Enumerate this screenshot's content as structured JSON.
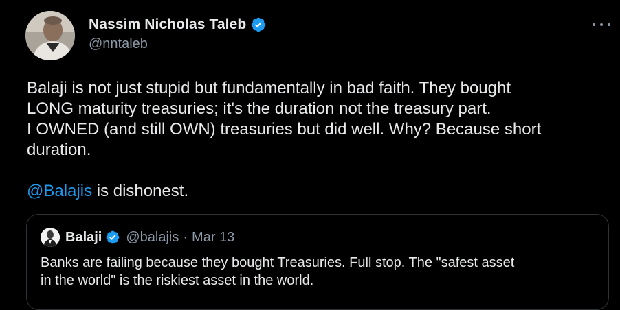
{
  "tweet": {
    "author": {
      "display_name": "Nassim Nicholas Taleb",
      "handle": "@nntaleb",
      "verified": true,
      "avatar_icon": "profile-photo"
    },
    "body_lines": [
      "Balaji is not just stupid but fundamentally in bad faith. They bought",
      "LONG maturity treasuries; it's the duration not the treasury part.",
      "I OWNED (and still OWN) treasuries but did well. Why? Because short",
      "duration."
    ],
    "mention": "@Balajis",
    "mention_suffix": " is dishonest.",
    "more_icon": "more-options-icon"
  },
  "quoted_tweet": {
    "display_name": "Balaji",
    "handle": "@balajis",
    "separator": "·",
    "date": "Mar 13",
    "verified": true,
    "text_lines": [
      "Banks are failing because they bought Treasuries. Full stop. The \"safest asset",
      "in the world\" is the riskiest asset in the world."
    ]
  },
  "colors": {
    "background": "#000000",
    "text_primary": "#e7e9ea",
    "text_secondary": "#8b98a5",
    "link": "#1d9bf0",
    "verified_badge": "#1d9bf0",
    "border": "#2f3336"
  }
}
